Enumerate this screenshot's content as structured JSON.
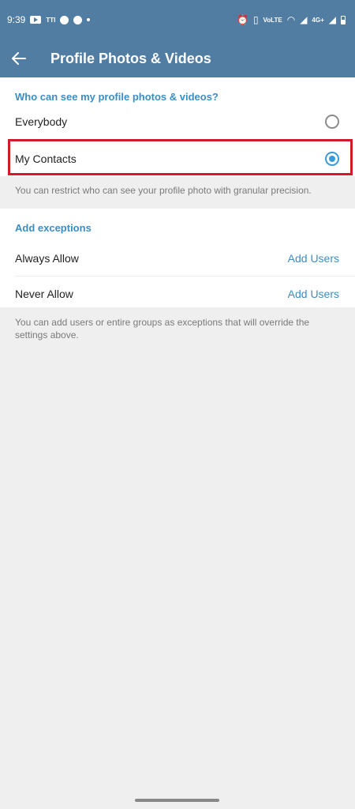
{
  "status_bar": {
    "time": "9:39",
    "carrier_text": "TTI",
    "network_label": "4G+",
    "volte_label": "VoLTE"
  },
  "toolbar": {
    "title": "Profile Photos & Videos"
  },
  "visibility": {
    "header": "Who can see my profile photos & videos?",
    "options": [
      {
        "label": "Everybody",
        "selected": false
      },
      {
        "label": "My Contacts",
        "selected": true
      }
    ],
    "hint": "You can restrict who can see your profile photo with granular precision."
  },
  "exceptions": {
    "header": "Add exceptions",
    "rows": [
      {
        "label": "Always Allow",
        "action": "Add Users"
      },
      {
        "label": "Never Allow",
        "action": "Add Users"
      }
    ],
    "hint": "You can add users or entire groups as exceptions that will override the settings above."
  },
  "colors": {
    "brand": "#527da3",
    "accent": "#3a9ad9",
    "highlight": "#d11a2a"
  }
}
